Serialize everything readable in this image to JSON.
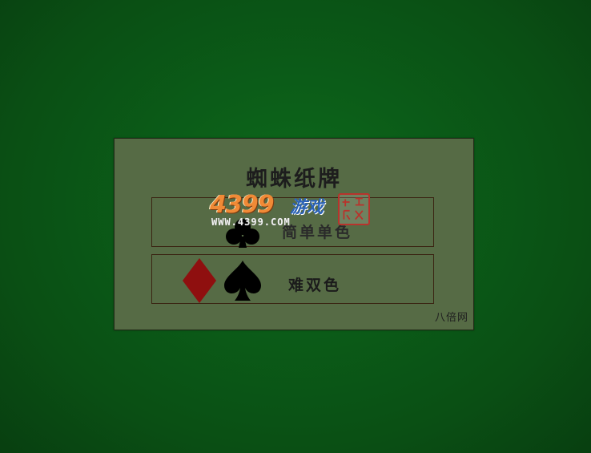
{
  "game": {
    "title": "蜘蛛纸牌",
    "options": [
      {
        "label": "简单单色",
        "suits": [
          "club"
        ]
      },
      {
        "label": "难双色",
        "suits": [
          "diamond",
          "spade"
        ]
      }
    ],
    "footer": "八倍网"
  },
  "watermark": {
    "brand_number": "4399",
    "brand_text": "游戏",
    "url": "WWW.4399.COM",
    "seal_text": "中文游戏"
  },
  "colors": {
    "background": "#0b5c18",
    "panel": "#566b45",
    "diamond": "#8f0f0f",
    "spade": "#000000"
  }
}
